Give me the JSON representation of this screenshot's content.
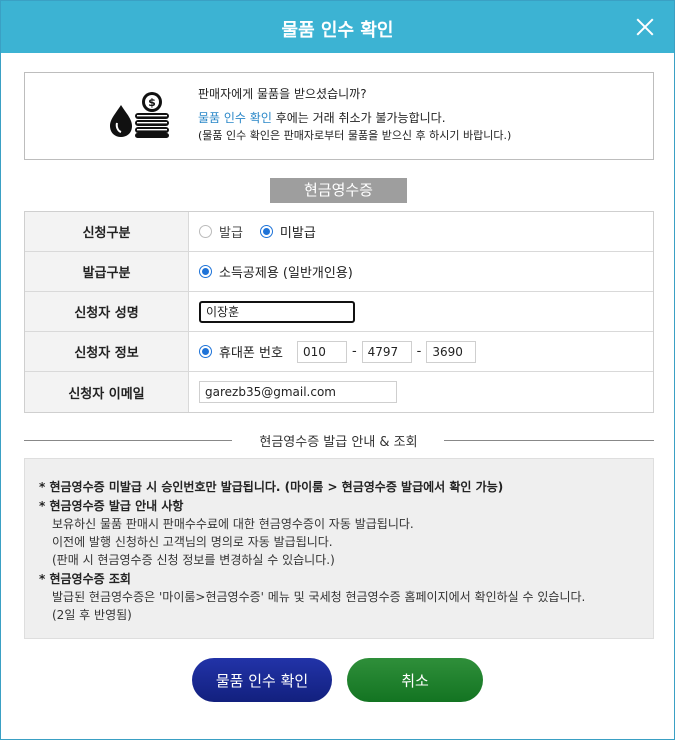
{
  "dialog": {
    "title": "물품 인수 확인",
    "close_icon": "close-icon"
  },
  "notice": {
    "icon": "money-coins-icon",
    "line1": "판매자에게 물품을 받으셨습니까?",
    "highlight": "물품 인수 확인",
    "line2_rest": " 후에는 거래 취소가 불가능합니다.",
    "line3": "(물품 인수 확인은 판매자로부터 물품을 받으신 후 하시기 바랍니다.)"
  },
  "section_title": "현금영수증",
  "form": {
    "apply_type": {
      "label": "신청구분",
      "options": [
        "발급",
        "미발급"
      ],
      "selected": "미발급"
    },
    "issue_type": {
      "label": "발급구분",
      "option": "소득공제용 (일반개인용)"
    },
    "applicant_name": {
      "label": "신청자 성명",
      "value": "이장훈"
    },
    "applicant_info": {
      "label": "신청자 정보",
      "option": "휴대폰 번호",
      "phone1": "010",
      "phone2": "4797",
      "phone3": "3690",
      "dash": "-"
    },
    "applicant_email": {
      "label": "신청자 이메일",
      "value": "garezb35@gmail.com"
    }
  },
  "guide": {
    "divider_title": "현금영수증 발급 안내 & 조회",
    "lines": [
      "* 현금영수증 미발급 시 승인번호만 발급됩니다. (마이룸 > 현금영수증 발급에서 확인 가능)",
      "* 현금영수증 발급 안내 사항",
      "보유하신 물품 판매시 판매수수료에 대한 현금영수증이 자동 발급됩니다.",
      "이전에 발행 신청하신 고객님의 명의로 자동 발급됩니다.",
      "(판매 시 현금영수증 신청 정보를 변경하실 수 있습니다.)",
      "* 현금영수증 조회",
      "발급된 현금영수증은 '마이룸>현금영수증' 메뉴 및 국세청 현금영수증 홈페이지에서 확인하실 수 있습니다.",
      "(2일 후 반영됨)"
    ]
  },
  "buttons": {
    "confirm": "물품 인수 확인",
    "cancel": "취소"
  },
  "colors": {
    "titlebar": "#3cb3d3",
    "confirm_button": "#1a2a95",
    "cancel_button": "#22843a",
    "highlight_text": "#2a87c8",
    "radio_selected": "#1e73d8"
  }
}
